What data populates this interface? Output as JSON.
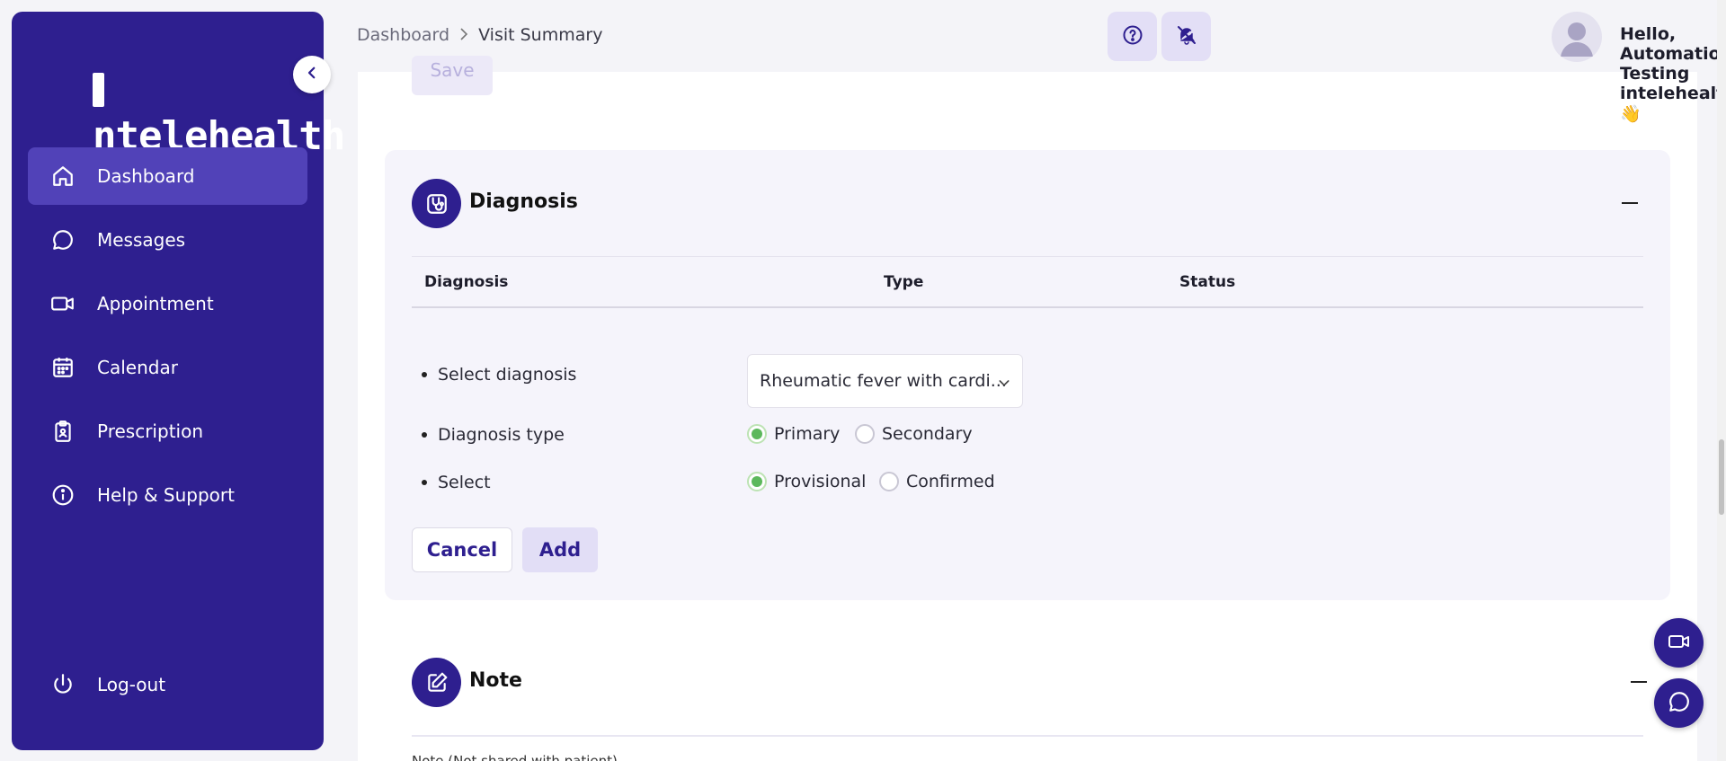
{
  "app": {
    "logo_text": "intelehealth",
    "logo_rest": "ntelehealth"
  },
  "sidebar": {
    "items": [
      {
        "label": "Dashboard",
        "icon": "home-icon",
        "active": true
      },
      {
        "label": "Messages",
        "icon": "chat-icon"
      },
      {
        "label": "Appointment",
        "icon": "video-icon"
      },
      {
        "label": "Calendar",
        "icon": "calendar-icon"
      },
      {
        "label": "Prescription",
        "icon": "clipboard-icon"
      },
      {
        "label": "Help & Support",
        "icon": "info-icon"
      }
    ],
    "logout_label": "Log-out"
  },
  "header": {
    "breadcrumb": {
      "root": "Dashboard",
      "separator": ">",
      "current": "Visit Summary"
    },
    "greeting": "Hello, Automation Testing intelehealth",
    "greeting_emoji": "👋"
  },
  "main": {
    "save_label": "Save",
    "diagnosis": {
      "title": "Diagnosis",
      "columns": [
        "Diagnosis",
        "Type",
        "Status"
      ],
      "form": {
        "select_diagnosis_label": "Select diagnosis",
        "select_diagnosis_value": "Rheumatic fever with cardi...",
        "diagnosis_type_label": "Diagnosis type",
        "type_options": [
          "Primary",
          "Secondary"
        ],
        "type_selected": "Primary",
        "select_label": "Select",
        "status_options": [
          "Provisional",
          "Confirmed"
        ],
        "status_selected": "Provisional"
      },
      "cancel_label": "Cancel",
      "add_label": "Add"
    },
    "note": {
      "title": "Note",
      "hint": "Note (Not shared with patient)"
    }
  },
  "colors": {
    "primary": "#2e1f8f",
    "active_nav": "#5142b8",
    "radio_selected": "#5cb85c",
    "card_bg": "#f5f4fb"
  }
}
